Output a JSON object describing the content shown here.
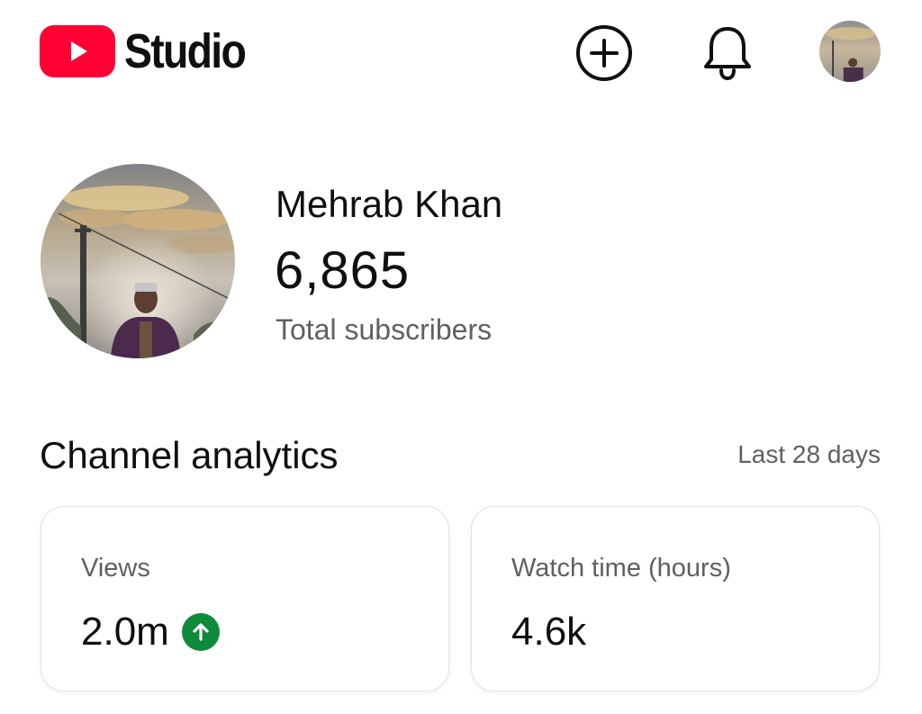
{
  "header": {
    "brand": "Studio",
    "brand_color": "#ff0033",
    "icons": [
      "youtube-logo-icon",
      "create-plus-icon",
      "bell-icon",
      "avatar"
    ]
  },
  "profile": {
    "name": "Mehrab Khan",
    "subscriber_count": "6,865",
    "subscriber_label": "Total subscribers"
  },
  "analytics": {
    "title": "Channel analytics",
    "period": "Last 28 days",
    "cards": [
      {
        "label": "Views",
        "value": "2.0m",
        "trend": "up",
        "trend_color": "#0f8a3a"
      },
      {
        "label": "Watch time (hours)",
        "value": "4.6k"
      }
    ]
  }
}
